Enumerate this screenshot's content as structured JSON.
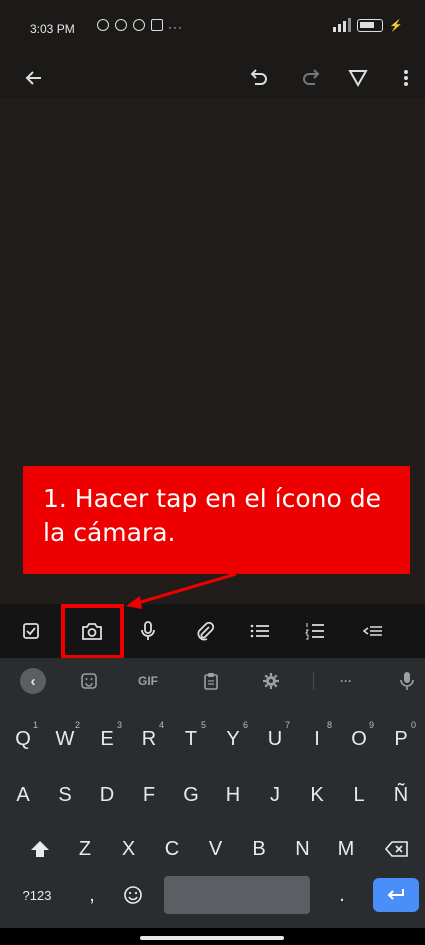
{
  "status_bar": {
    "time": "3:03 PM",
    "dots": "···"
  },
  "app_bar": {
    "back_icon": "back-arrow-icon",
    "undo_icon": "undo-icon",
    "redo_icon": "redo-icon",
    "format_icon": "text-format-icon",
    "more_icon": "more-vert-icon"
  },
  "callout": {
    "text": "1. Hacer tap en el ícono de la cámara.",
    "color": "#ee0000"
  },
  "toolbar": {
    "items": [
      "checkbox-icon",
      "camera-icon",
      "mic-icon",
      "attach-icon",
      "bullet-list-icon",
      "numbered-list-icon",
      "outdent-icon"
    ]
  },
  "keyboard": {
    "top_row": {
      "gif_label": "GIF",
      "more_label": "···"
    },
    "row1": [
      "Q",
      "W",
      "E",
      "R",
      "T",
      "Y",
      "U",
      "I",
      "O",
      "P"
    ],
    "row1_hints": [
      "1",
      "2",
      "3",
      "4",
      "5",
      "6",
      "7",
      "8",
      "9",
      "0"
    ],
    "row2": [
      "A",
      "S",
      "D",
      "F",
      "G",
      "H",
      "J",
      "K",
      "L",
      "Ñ"
    ],
    "row3": [
      "Z",
      "X",
      "C",
      "V",
      "B",
      "N",
      "M"
    ],
    "symbols_label": "?123",
    "comma_label": ",",
    "period_label": ".",
    "enter_color": "#4a8ff7"
  }
}
